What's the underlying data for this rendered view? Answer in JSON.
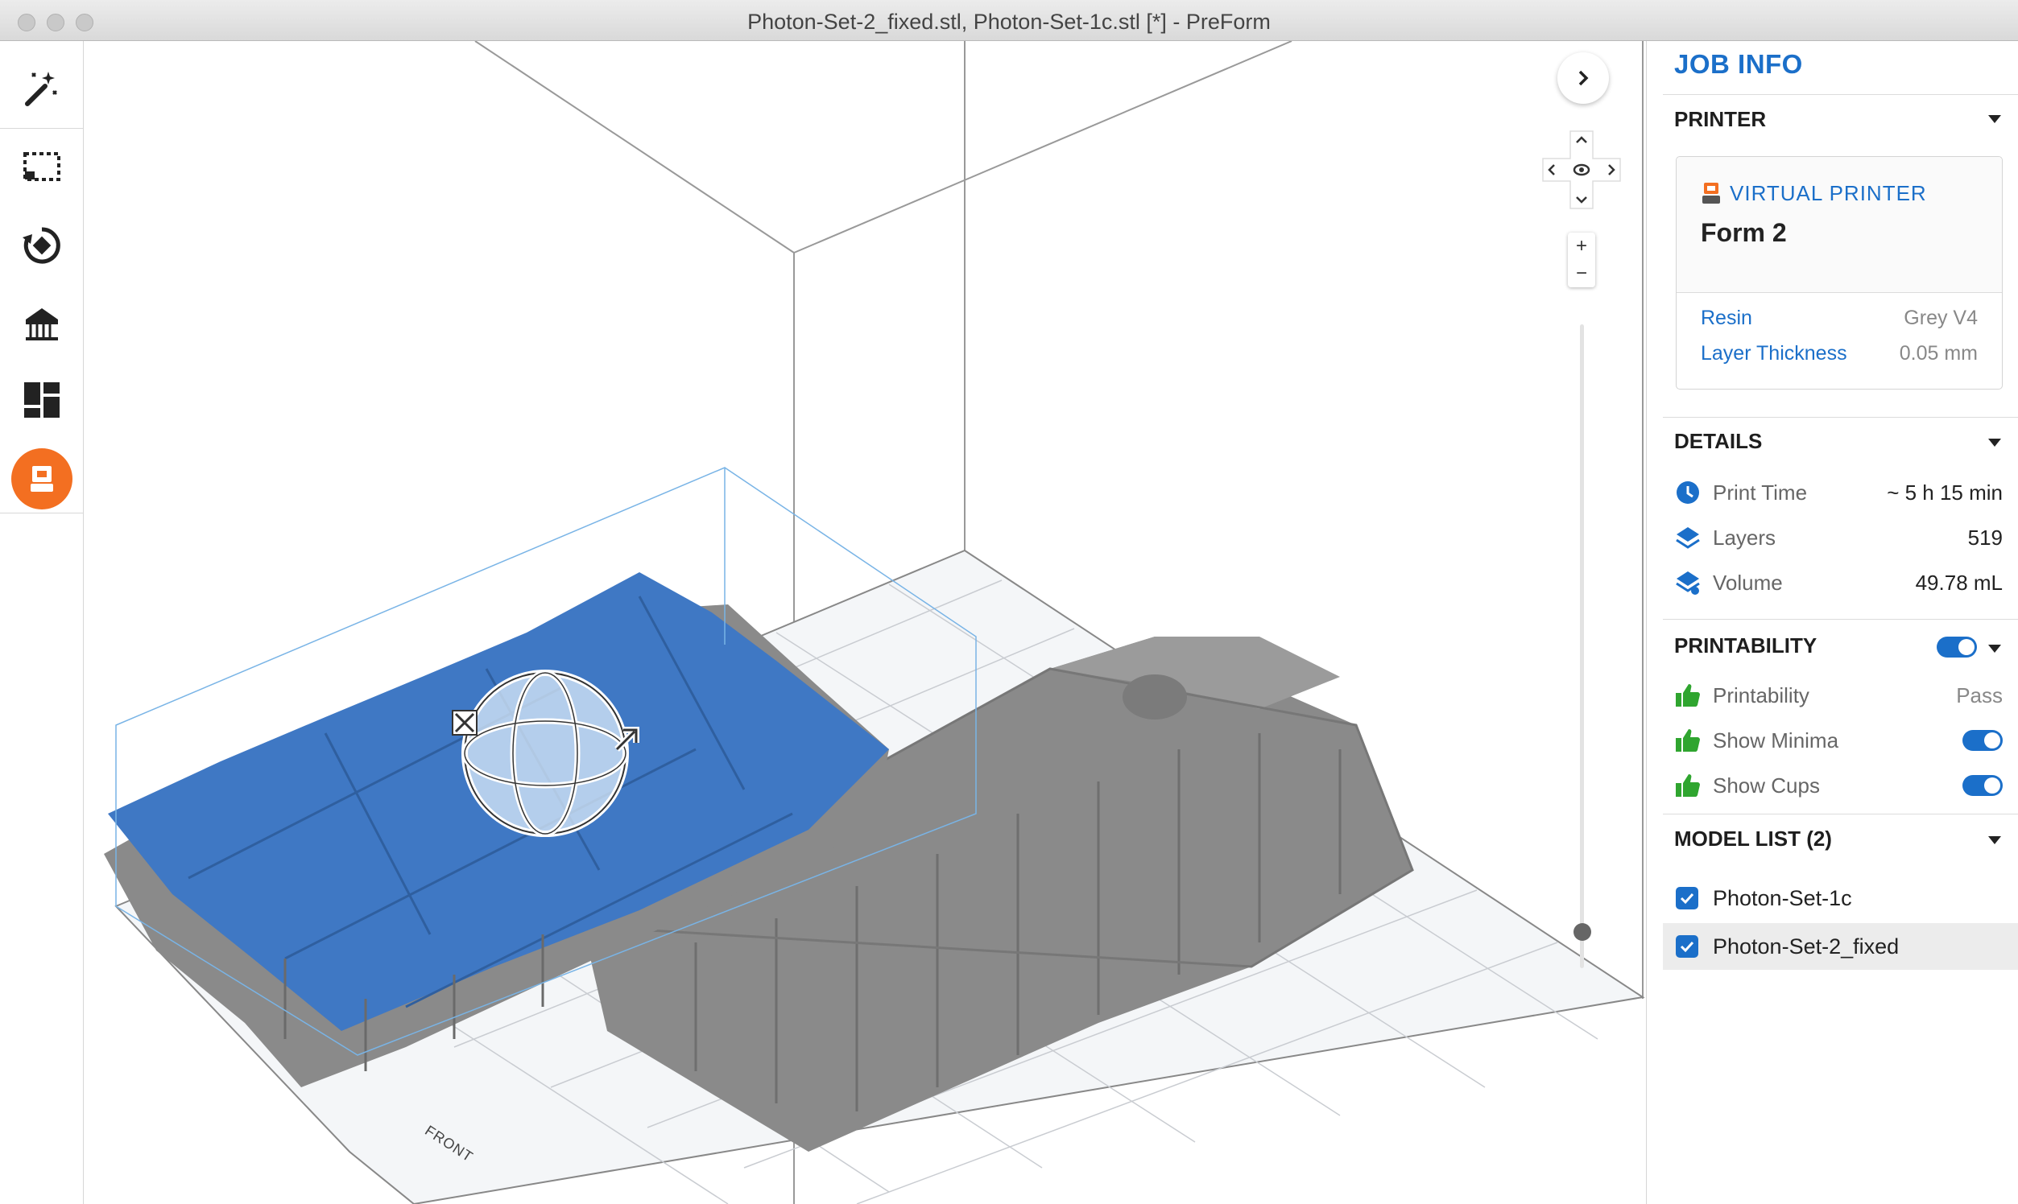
{
  "window": {
    "title": "Photon-Set-2_fixed.stl, Photon-Set-1c.stl [*] - PreForm"
  },
  "toolbar": {
    "tools": [
      {
        "icon": "magic-wand-icon"
      },
      {
        "icon": "select-box-icon"
      },
      {
        "icon": "orient-icon"
      },
      {
        "icon": "supports-icon"
      },
      {
        "icon": "layout-icon"
      },
      {
        "icon": "print-icon",
        "active": true
      }
    ],
    "accent": "#f36f21"
  },
  "viewport": {
    "front_label": "FRONT",
    "zoom_in": "+",
    "zoom_out": "−",
    "selected_color": "#3f78c4",
    "model_color": "#8a8a8a"
  },
  "panel": {
    "title": "JOB INFO",
    "printer": {
      "heading": "PRINTER",
      "type": "VIRTUAL PRINTER",
      "name": "Form 2",
      "resin_label": "Resin",
      "resin_value": "Grey V4",
      "layer_label": "Layer Thickness",
      "layer_value": "0.05 mm"
    },
    "details": {
      "heading": "DETAILS",
      "print_time_label": "Print Time",
      "print_time_value": "~ 5 h 15 min",
      "layers_label": "Layers",
      "layers_value": "519",
      "volume_label": "Volume",
      "volume_value": "49.78 mL"
    },
    "printability": {
      "heading": "PRINTABILITY",
      "enabled": true,
      "status_label": "Printability",
      "status_value": "Pass",
      "minima_label": "Show Minima",
      "minima_on": true,
      "cups_label": "Show Cups",
      "cups_on": true
    },
    "models": {
      "heading": "MODEL LIST (2)",
      "items": [
        {
          "name": "Photon-Set-1c",
          "checked": true,
          "selected": false
        },
        {
          "name": "Photon-Set-2_fixed",
          "checked": true,
          "selected": true
        }
      ]
    },
    "accent": "#1b6fc9",
    "pass_color": "#2fa52f"
  }
}
